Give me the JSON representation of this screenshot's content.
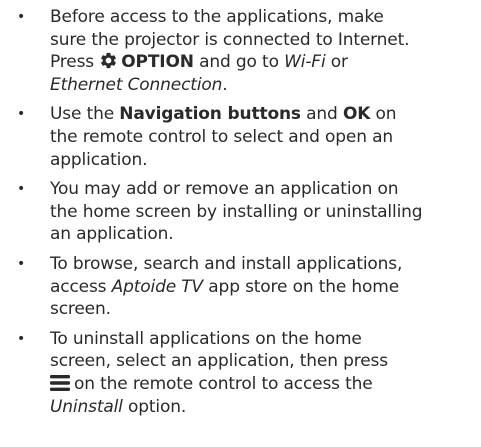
{
  "bullet_symbol": "•",
  "items": [
    {
      "lines": [
        {
          "t1": "Before access to the applications, make"
        },
        {
          "t1": "sure the projector is connected to Internet."
        },
        {
          "t1": "Press ",
          "icon": "gear-icon",
          "b1": "OPTION",
          "t2": " and go to ",
          "i1": "Wi-Fi",
          "t3": " or"
        },
        {
          "i1": "Ethernet Connection",
          "t2": "."
        }
      ]
    },
    {
      "lines": [
        {
          "t1": "Use the ",
          "b1": "Navigation buttons",
          "t2": " and ",
          "b2": "OK",
          "t3": " on"
        },
        {
          "t1": "the remote control to select and open an"
        },
        {
          "t1": "application."
        }
      ]
    },
    {
      "lines": [
        {
          "t1": "You may add or remove an application on"
        },
        {
          "t1": "the home screen by installing or uninstalling"
        },
        {
          "t1": "an application."
        }
      ]
    },
    {
      "lines": [
        {
          "t1": "To browse, search and install applications,"
        },
        {
          "t1": "access ",
          "i1": "Aptoide TV",
          "t2": " app store on the home"
        },
        {
          "t1": "screen."
        }
      ]
    },
    {
      "lines": [
        {
          "t1": "To uninstall applications on the home"
        },
        {
          "t1": "screen, select an application, then press"
        },
        {
          "icon": "menu-icon",
          "t1": "on the remote control to access the"
        },
        {
          "i1": "Uninstall",
          "t2": " option."
        }
      ]
    }
  ]
}
